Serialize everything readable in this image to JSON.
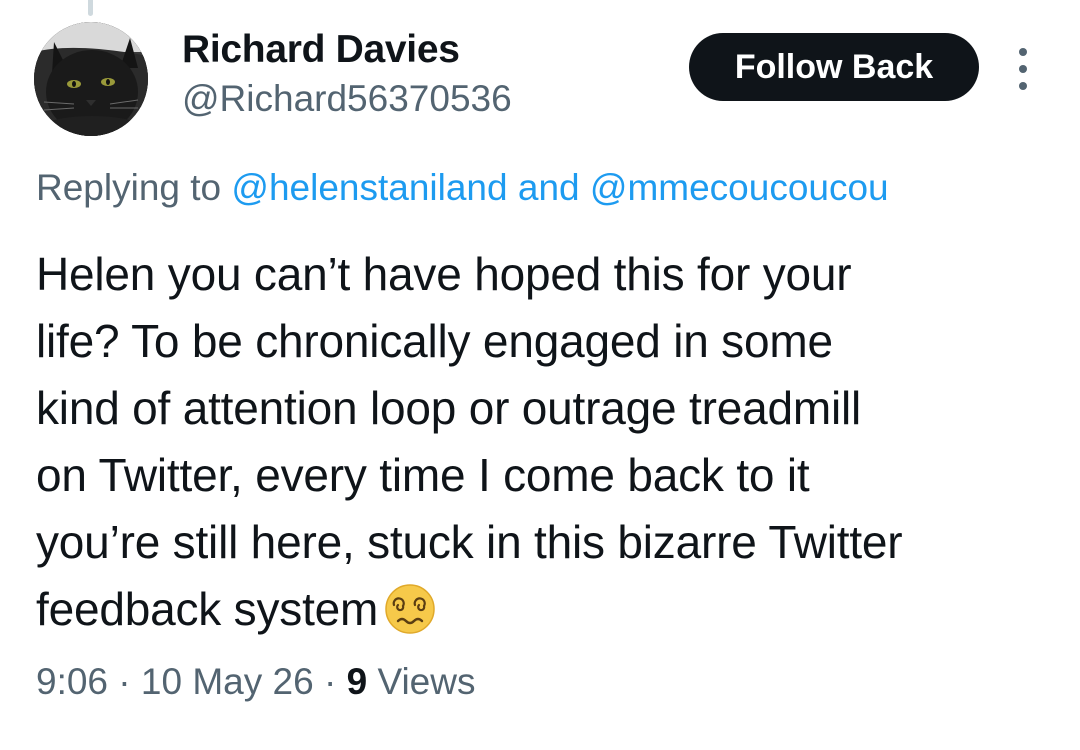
{
  "tweet": {
    "author": {
      "display_name": "Richard Davies",
      "handle": "@Richard56370536",
      "avatar_icon": "black-cat-avatar"
    },
    "follow_button_label": "Follow Back",
    "more_icon": "more-vertical-icon",
    "replying": {
      "prefix": "Replying to",
      "mention_1": "@helenstaniland",
      "conjunction": "and",
      "mention_2": "@mmecoucoucou"
    },
    "text_lines": [
      "Helen you can’t have hoped this for your",
      "life? To be chronically engaged in some",
      "kind of attention loop or outrage treadmill",
      "on Twitter, every time I come back to it",
      "you’re still here, stuck in this bizarre Twitter",
      "feedback system"
    ],
    "emoji": "woozy-dizzy-face-emoji",
    "meta": {
      "time": "9:06",
      "separator": "·",
      "date": "10 May 26",
      "views_count": "9",
      "views_label": "Views"
    },
    "colors": {
      "link": "#1d9bf0",
      "secondary_text": "#536471",
      "primary_text": "#0f1419",
      "button_bg": "#0f1419"
    }
  }
}
